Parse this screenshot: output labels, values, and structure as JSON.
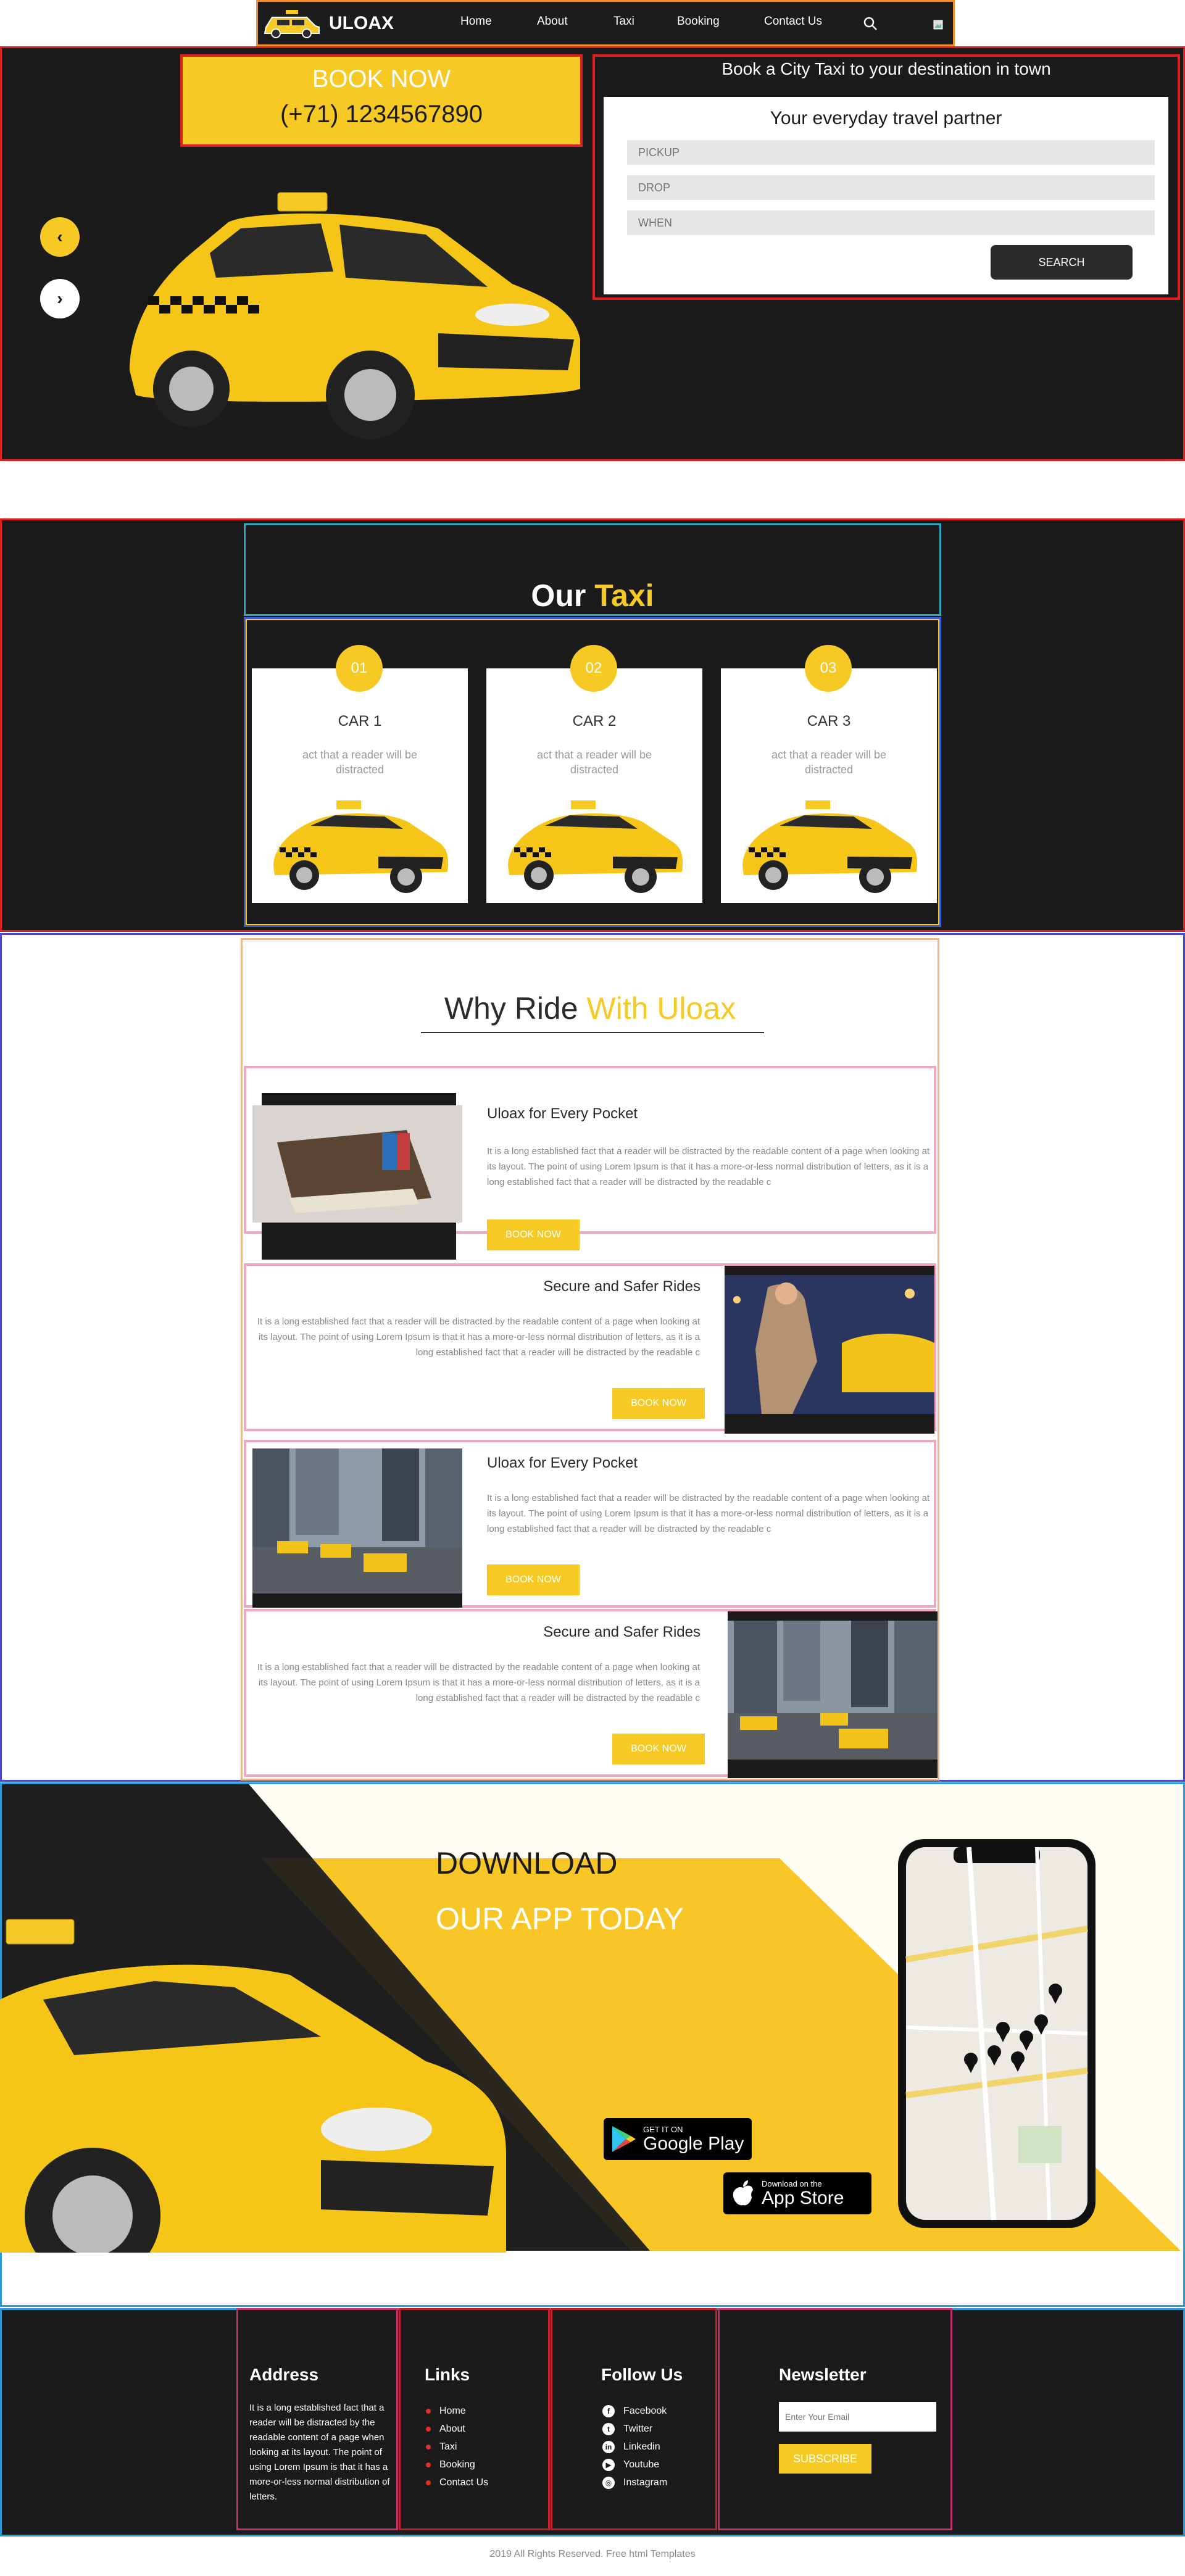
{
  "colors": {
    "accent": "#f7c924",
    "dark": "#1b1b1b",
    "outline_red": "#e02020"
  },
  "nav": {
    "logo_text": "ULOAX",
    "links": [
      "Home",
      "About",
      "Taxi",
      "Booking",
      "Contact Us"
    ],
    "icons": [
      "search-icon",
      "user-icon"
    ]
  },
  "hero": {
    "book_now": "BOOK NOW",
    "phone": "(+71) 1234567890",
    "form_title": "Book a City Taxi to your destination in town",
    "form_subtitle": "Your everyday travel partner",
    "pickup_placeholder": "PICKUP",
    "drop_placeholder": "DROP",
    "when_placeholder": "WHEN",
    "search_label": "SEARCH",
    "prev_icon": "chevron-left-icon",
    "next_icon": "chevron-right-icon"
  },
  "our_taxi": {
    "title_a": "Our",
    "title_b": "Taxi",
    "cards": [
      {
        "num": "01",
        "name": "CAR 1",
        "desc": "act that a reader will be distracted"
      },
      {
        "num": "02",
        "name": "CAR 2",
        "desc": "act that a reader will be distracted"
      },
      {
        "num": "03",
        "name": "CAR 3",
        "desc": "act that a reader will be distracted"
      }
    ]
  },
  "why": {
    "title_a": "Why Ride",
    "title_b": "With Uloax",
    "rows": [
      {
        "title": "Uloax for Every Pocket",
        "text": "It is a long established fact that a reader will be distracted by the readable content of a page when looking at its layout. The point of using Lorem Ipsum is that it has a more-or-less normal distribution of letters, as it is a long established fact that a reader will be distracted by the readable c",
        "button": "BOOK NOW"
      },
      {
        "title": "Secure and Safer Rides",
        "text": "It is a long established fact that a reader will be distracted by the readable content of a page when looking at its layout. The point of using Lorem Ipsum is that it has a more-or-less normal distribution of letters, as it is a long established fact that a reader will be distracted by the readable c",
        "button": "BOOK NOW"
      },
      {
        "title": "Uloax for Every Pocket",
        "text": "It is a long established fact that a reader will be distracted by the readable content of a page when looking at its layout. The point of using Lorem Ipsum is that it has a more-or-less normal distribution of letters, as it is a long established fact that a reader will be distracted by the readable c",
        "button": "BOOK NOW"
      },
      {
        "title": "Secure and Safer Rides",
        "text": "It is a long established fact that a reader will be distracted by the readable content of a page when looking at its layout. The point of using Lorem Ipsum is that it has a more-or-less normal distribution of letters, as it is a long established fact that a reader will be distracted by the readable c",
        "button": "BOOK NOW"
      }
    ]
  },
  "download": {
    "line1": "DOWNLOAD",
    "line2": "OUR APP TODAY",
    "gp_small": "GET IT ON",
    "gp_big": "Google Play",
    "as_small": "Download on the",
    "as_big": "App Store"
  },
  "footer": {
    "address_title": "Address",
    "address_text": "It is a long established fact that a reader will be distracted by the readable content of a page when looking at its layout. The point of using Lorem Ipsum is that it has a more-or-less normal distribution of letters.",
    "links_title": "Links",
    "links": [
      "Home",
      "About",
      "Taxi",
      "Booking",
      "Contact Us"
    ],
    "follow_title": "Follow Us",
    "social": [
      {
        "label": "Facebook",
        "icon": "facebook-icon"
      },
      {
        "label": "Twitter",
        "icon": "twitter-icon"
      },
      {
        "label": "Linkedin",
        "icon": "linkedin-icon"
      },
      {
        "label": "Youtube",
        "icon": "youtube-icon"
      },
      {
        "label": "Instagram",
        "icon": "instagram-icon"
      }
    ],
    "newsletter_title": "Newsletter",
    "email_placeholder": "Enter Your Email",
    "subscribe_label": "SUBSCRIBE",
    "copyright": "2019 All Rights Reserved. Free html Templates"
  }
}
